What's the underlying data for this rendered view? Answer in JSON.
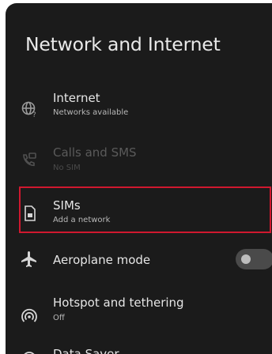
{
  "header": {
    "title": "Network and Internet"
  },
  "items": [
    {
      "label": "Internet",
      "subtitle": "Networks available",
      "icon": "globe-wifi-icon",
      "enabled": true
    },
    {
      "label": "Calls and SMS",
      "subtitle": "No SIM",
      "icon": "phone-sms-icon",
      "enabled": false
    },
    {
      "label": "SIMs",
      "subtitle": "Add a network",
      "icon": "sim-card-icon",
      "enabled": true,
      "highlighted": true
    },
    {
      "label": "Aeroplane mode",
      "icon": "airplane-icon",
      "enabled": true,
      "toggle": "off"
    },
    {
      "label": "Hotspot and tethering",
      "subtitle": "Off",
      "icon": "hotspot-icon",
      "enabled": true
    },
    {
      "label": "Data Saver",
      "icon": "data-saver-icon",
      "enabled": true
    }
  ],
  "colors": {
    "background": "#1b1b1b",
    "highlight": "#d0182f",
    "text": "#e6e6e6"
  }
}
